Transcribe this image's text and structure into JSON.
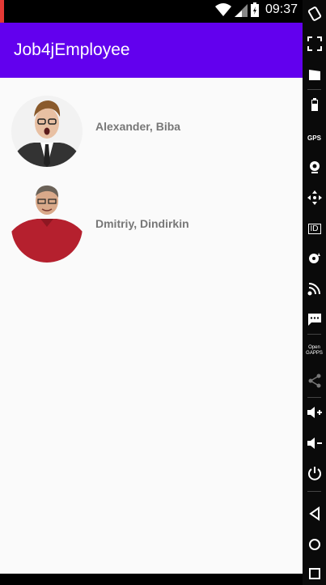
{
  "status_bar": {
    "time": "09:37"
  },
  "app_bar": {
    "title": "Job4jEmployee"
  },
  "employees": [
    {
      "name": "Alexander, Biba"
    },
    {
      "name": "Dmitriy, Dindirkin"
    }
  ],
  "emulator_panel": {
    "items": [
      "rotate-icon",
      "fullscreen-icon",
      "clapperboard-icon",
      "battery-icon",
      "gps-icon",
      "camera-icon",
      "move-icon",
      "id-icon",
      "disk-icon",
      "rss-icon",
      "sms-icon",
      "opengapps-icon",
      "share-icon",
      "volume-up-icon",
      "volume-down-icon",
      "power-icon",
      "back-icon",
      "home-icon",
      "recents-icon"
    ],
    "gps_label": "GPS",
    "id_label": "ID",
    "open_gapps_label": "Open GAPPS"
  },
  "colors": {
    "app_bar": "#6200ee",
    "background": "#fafafa",
    "name_text": "#777777"
  }
}
